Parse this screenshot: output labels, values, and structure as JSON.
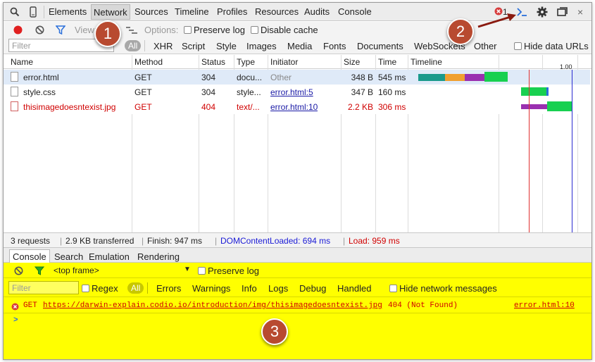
{
  "tabs": {
    "elements": "Elements",
    "network": "Network",
    "sources": "Sources",
    "timeline": "Timeline",
    "profiles": "Profiles",
    "resources": "Resources",
    "audits": "Audits",
    "console": "Console"
  },
  "error_count": "1",
  "toolbar": {
    "view_label": "View:",
    "options_label": "Options:",
    "preserve_log": "Preserve log",
    "disable_cache": "Disable cache"
  },
  "filter": {
    "placeholder": "Filter",
    "types": [
      "All",
      "XHR",
      "Script",
      "Style",
      "Images",
      "Media",
      "Fonts",
      "Documents",
      "WebSockets",
      "Other"
    ],
    "hide_data_urls": "Hide data URLs"
  },
  "columns": {
    "name": "Name",
    "method": "Method",
    "status": "Status",
    "type": "Type",
    "initiator": "Initiator",
    "size": "Size",
    "time": "Time",
    "timeline": "Timeline",
    "timeline_tick": "1.00"
  },
  "requests": [
    {
      "name": "error.html",
      "method": "GET",
      "status": "304",
      "type": "docu...",
      "initiator": "Other",
      "size": "348 B",
      "time": "545 ms"
    },
    {
      "name": "style.css",
      "method": "GET",
      "status": "304",
      "type": "style...",
      "initiator": "error.html:5",
      "size": "347 B",
      "time": "160 ms"
    },
    {
      "name": "thisimagedoesntexist.jpg",
      "method": "GET",
      "status": "404",
      "type": "text/...",
      "initiator": "error.html:10",
      "size": "2.2 KB",
      "time": "306 ms"
    }
  ],
  "summary": {
    "requests": "3 requests",
    "transferred": "2.9 KB transferred",
    "finish": "Finish: 947 ms",
    "dom": "DOMContentLoaded: 694 ms",
    "load": "Load: 959 ms"
  },
  "drawer_tabs": {
    "console": "Console",
    "search": "Search",
    "emulation": "Emulation",
    "rendering": "Rendering"
  },
  "console": {
    "frame": "<top frame>",
    "preserve_log": "Preserve log",
    "filter_placeholder": "Filter",
    "regex": "Regex",
    "levels": [
      "All",
      "Errors",
      "Warnings",
      "Info",
      "Logs",
      "Debug",
      "Handled"
    ],
    "hide_network": "Hide network messages",
    "error": {
      "method": "GET",
      "url": "https://darwin-explain.codio.io/introduction/img/thisimagedoesntexist.jpg",
      "status": "404 (Not Found)",
      "source": "error.html:10"
    },
    "prompt": ">"
  },
  "callouts": [
    "1",
    "2",
    "3"
  ],
  "colors": {
    "error_red": "#d00000",
    "dom_blue": "#1a1ad6",
    "console_yellow": "#ffff00",
    "callout": "#b84a30"
  }
}
